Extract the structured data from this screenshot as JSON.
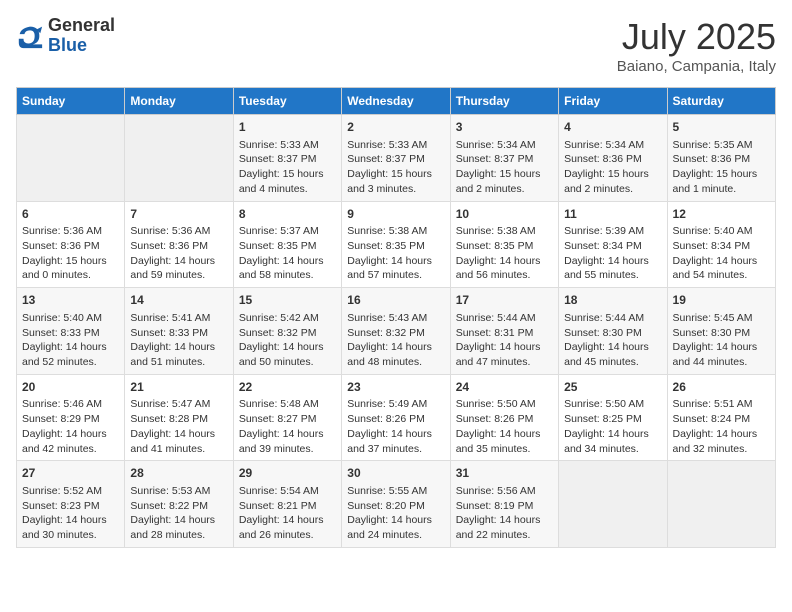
{
  "header": {
    "logo_general": "General",
    "logo_blue": "Blue",
    "month_title": "July 2025",
    "location": "Baiano, Campania, Italy"
  },
  "weekdays": [
    "Sunday",
    "Monday",
    "Tuesday",
    "Wednesday",
    "Thursday",
    "Friday",
    "Saturday"
  ],
  "weeks": [
    [
      {
        "day": "",
        "info": ""
      },
      {
        "day": "",
        "info": ""
      },
      {
        "day": "1",
        "info": "Sunrise: 5:33 AM\nSunset: 8:37 PM\nDaylight: 15 hours and 4 minutes."
      },
      {
        "day": "2",
        "info": "Sunrise: 5:33 AM\nSunset: 8:37 PM\nDaylight: 15 hours and 3 minutes."
      },
      {
        "day": "3",
        "info": "Sunrise: 5:34 AM\nSunset: 8:37 PM\nDaylight: 15 hours and 2 minutes."
      },
      {
        "day": "4",
        "info": "Sunrise: 5:34 AM\nSunset: 8:36 PM\nDaylight: 15 hours and 2 minutes."
      },
      {
        "day": "5",
        "info": "Sunrise: 5:35 AM\nSunset: 8:36 PM\nDaylight: 15 hours and 1 minute."
      }
    ],
    [
      {
        "day": "6",
        "info": "Sunrise: 5:36 AM\nSunset: 8:36 PM\nDaylight: 15 hours and 0 minutes."
      },
      {
        "day": "7",
        "info": "Sunrise: 5:36 AM\nSunset: 8:36 PM\nDaylight: 14 hours and 59 minutes."
      },
      {
        "day": "8",
        "info": "Sunrise: 5:37 AM\nSunset: 8:35 PM\nDaylight: 14 hours and 58 minutes."
      },
      {
        "day": "9",
        "info": "Sunrise: 5:38 AM\nSunset: 8:35 PM\nDaylight: 14 hours and 57 minutes."
      },
      {
        "day": "10",
        "info": "Sunrise: 5:38 AM\nSunset: 8:35 PM\nDaylight: 14 hours and 56 minutes."
      },
      {
        "day": "11",
        "info": "Sunrise: 5:39 AM\nSunset: 8:34 PM\nDaylight: 14 hours and 55 minutes."
      },
      {
        "day": "12",
        "info": "Sunrise: 5:40 AM\nSunset: 8:34 PM\nDaylight: 14 hours and 54 minutes."
      }
    ],
    [
      {
        "day": "13",
        "info": "Sunrise: 5:40 AM\nSunset: 8:33 PM\nDaylight: 14 hours and 52 minutes."
      },
      {
        "day": "14",
        "info": "Sunrise: 5:41 AM\nSunset: 8:33 PM\nDaylight: 14 hours and 51 minutes."
      },
      {
        "day": "15",
        "info": "Sunrise: 5:42 AM\nSunset: 8:32 PM\nDaylight: 14 hours and 50 minutes."
      },
      {
        "day": "16",
        "info": "Sunrise: 5:43 AM\nSunset: 8:32 PM\nDaylight: 14 hours and 48 minutes."
      },
      {
        "day": "17",
        "info": "Sunrise: 5:44 AM\nSunset: 8:31 PM\nDaylight: 14 hours and 47 minutes."
      },
      {
        "day": "18",
        "info": "Sunrise: 5:44 AM\nSunset: 8:30 PM\nDaylight: 14 hours and 45 minutes."
      },
      {
        "day": "19",
        "info": "Sunrise: 5:45 AM\nSunset: 8:30 PM\nDaylight: 14 hours and 44 minutes."
      }
    ],
    [
      {
        "day": "20",
        "info": "Sunrise: 5:46 AM\nSunset: 8:29 PM\nDaylight: 14 hours and 42 minutes."
      },
      {
        "day": "21",
        "info": "Sunrise: 5:47 AM\nSunset: 8:28 PM\nDaylight: 14 hours and 41 minutes."
      },
      {
        "day": "22",
        "info": "Sunrise: 5:48 AM\nSunset: 8:27 PM\nDaylight: 14 hours and 39 minutes."
      },
      {
        "day": "23",
        "info": "Sunrise: 5:49 AM\nSunset: 8:26 PM\nDaylight: 14 hours and 37 minutes."
      },
      {
        "day": "24",
        "info": "Sunrise: 5:50 AM\nSunset: 8:26 PM\nDaylight: 14 hours and 35 minutes."
      },
      {
        "day": "25",
        "info": "Sunrise: 5:50 AM\nSunset: 8:25 PM\nDaylight: 14 hours and 34 minutes."
      },
      {
        "day": "26",
        "info": "Sunrise: 5:51 AM\nSunset: 8:24 PM\nDaylight: 14 hours and 32 minutes."
      }
    ],
    [
      {
        "day": "27",
        "info": "Sunrise: 5:52 AM\nSunset: 8:23 PM\nDaylight: 14 hours and 30 minutes."
      },
      {
        "day": "28",
        "info": "Sunrise: 5:53 AM\nSunset: 8:22 PM\nDaylight: 14 hours and 28 minutes."
      },
      {
        "day": "29",
        "info": "Sunrise: 5:54 AM\nSunset: 8:21 PM\nDaylight: 14 hours and 26 minutes."
      },
      {
        "day": "30",
        "info": "Sunrise: 5:55 AM\nSunset: 8:20 PM\nDaylight: 14 hours and 24 minutes."
      },
      {
        "day": "31",
        "info": "Sunrise: 5:56 AM\nSunset: 8:19 PM\nDaylight: 14 hours and 22 minutes."
      },
      {
        "day": "",
        "info": ""
      },
      {
        "day": "",
        "info": ""
      }
    ]
  ]
}
